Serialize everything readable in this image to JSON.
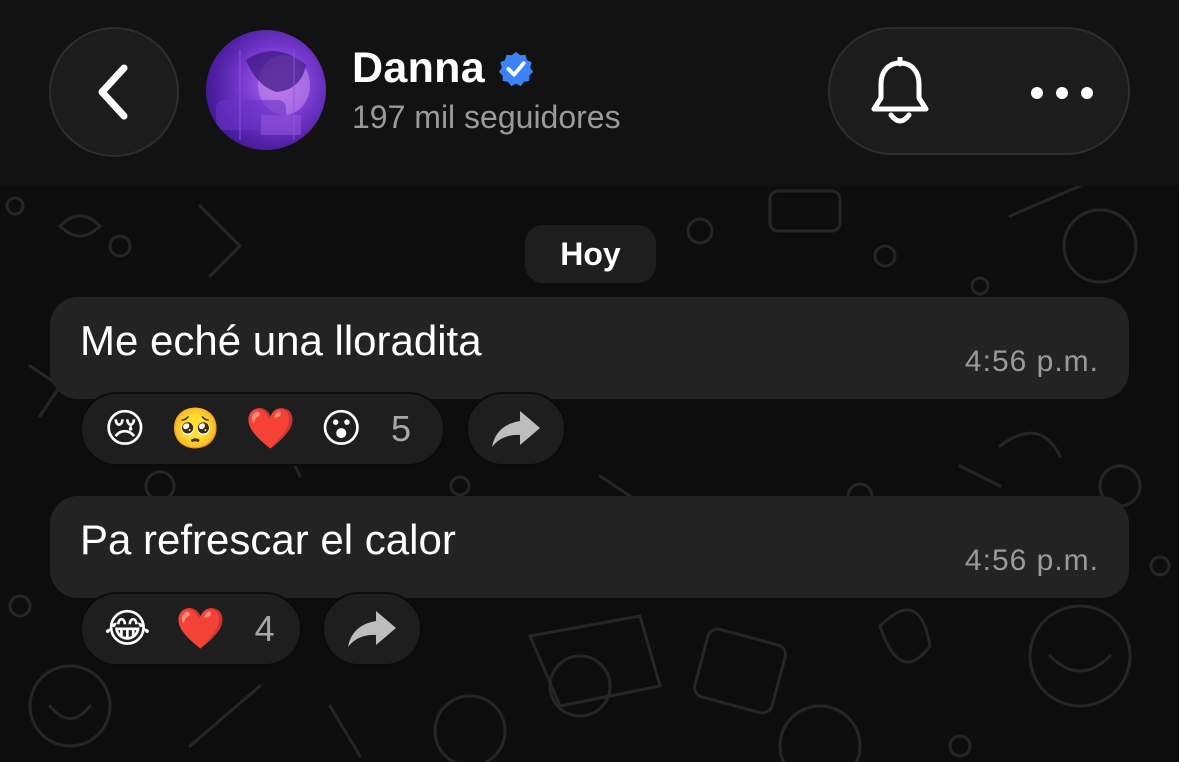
{
  "header": {
    "contact_name": "Danna",
    "followers_text": "197 mil seguidores",
    "icons": {
      "back": "chevron-left-icon",
      "verified": "verified-badge-icon",
      "notifications": "bell-icon",
      "menu": "more-horizontal-icon"
    }
  },
  "chat": {
    "date_label": "Hoy",
    "messages": [
      {
        "text": "Me eché una lloradita",
        "time": "4:56 p.m.",
        "reactions": [
          "😢",
          "🥺",
          "❤️",
          "😮"
        ],
        "reaction_count": "5"
      },
      {
        "text": "Pa refrescar el calor",
        "time": "4:56 p.m.",
        "reactions": [
          "😂",
          "❤️"
        ],
        "reaction_count": "4"
      }
    ]
  },
  "colors": {
    "background": "#0b0b0b",
    "header": "#121212",
    "bubble": "#232323",
    "verified": "#3b82f6",
    "secondary_text": "#9a9a9a"
  }
}
